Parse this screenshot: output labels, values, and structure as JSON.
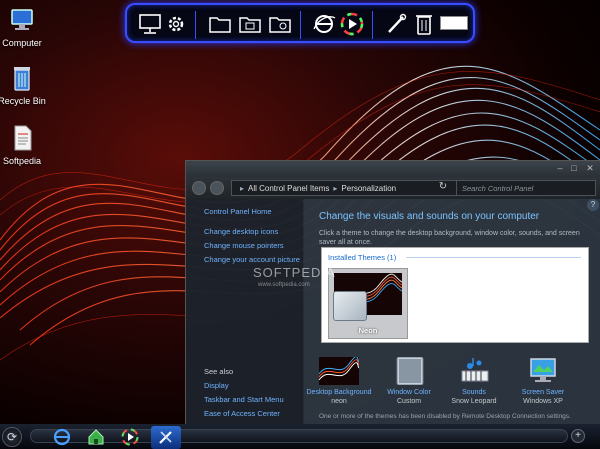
{
  "desktop": {
    "icons": [
      {
        "label": "Computer",
        "icon": "computer-icon"
      },
      {
        "label": "Recycle Bin",
        "icon": "recycle-bin-icon"
      },
      {
        "label": "Softpedia",
        "icon": "document-icon"
      }
    ]
  },
  "top_dock": {
    "items": [
      "monitor-icon",
      "gear-settings-icon",
      "folder-icon",
      "folder-grid-icon",
      "folder-image-icon",
      "internet-explorer-icon",
      "media-player-icon",
      "tools-icon",
      "trash-icon"
    ]
  },
  "window": {
    "breadcrumb": [
      "All Control Panel Items",
      "Personalization"
    ],
    "search_placeholder": "Search Control Panel",
    "left_links": [
      "Control Panel Home",
      "Change desktop icons",
      "Change mouse pointers",
      "Change your account picture"
    ],
    "see_also_title": "See also",
    "see_also_links": [
      "Display",
      "Taskbar and Start Menu",
      "Ease of Access Center"
    ],
    "heading": "Change the visuals and sounds on your computer",
    "subheading": "Click a theme to change the desktop background, window color, sounds, and screen saver all at once.",
    "installed_themes_label": "Installed Themes (1)",
    "theme_name": "Neon",
    "bottom": [
      {
        "name": "Desktop Background",
        "value": "neon"
      },
      {
        "name": "Window Color",
        "value": "Custom"
      },
      {
        "name": "Sounds",
        "value": "Snow Leopard"
      },
      {
        "name": "Screen Saver",
        "value": "Windows XP"
      }
    ],
    "notice": "One or more of the themes has been disabled by Remote Desktop Connection settings."
  },
  "watermark": {
    "main": "SOFTPEDIA",
    "sub": "www.softpedia.com"
  },
  "taskbar": {
    "items": [
      "internet-explorer-icon",
      "home-icon",
      "media-player-icon",
      "tools-icon"
    ]
  },
  "colors": {
    "accent": "#3a4cff",
    "link": "#6fb3ff",
    "heading": "#7cc4ff"
  }
}
